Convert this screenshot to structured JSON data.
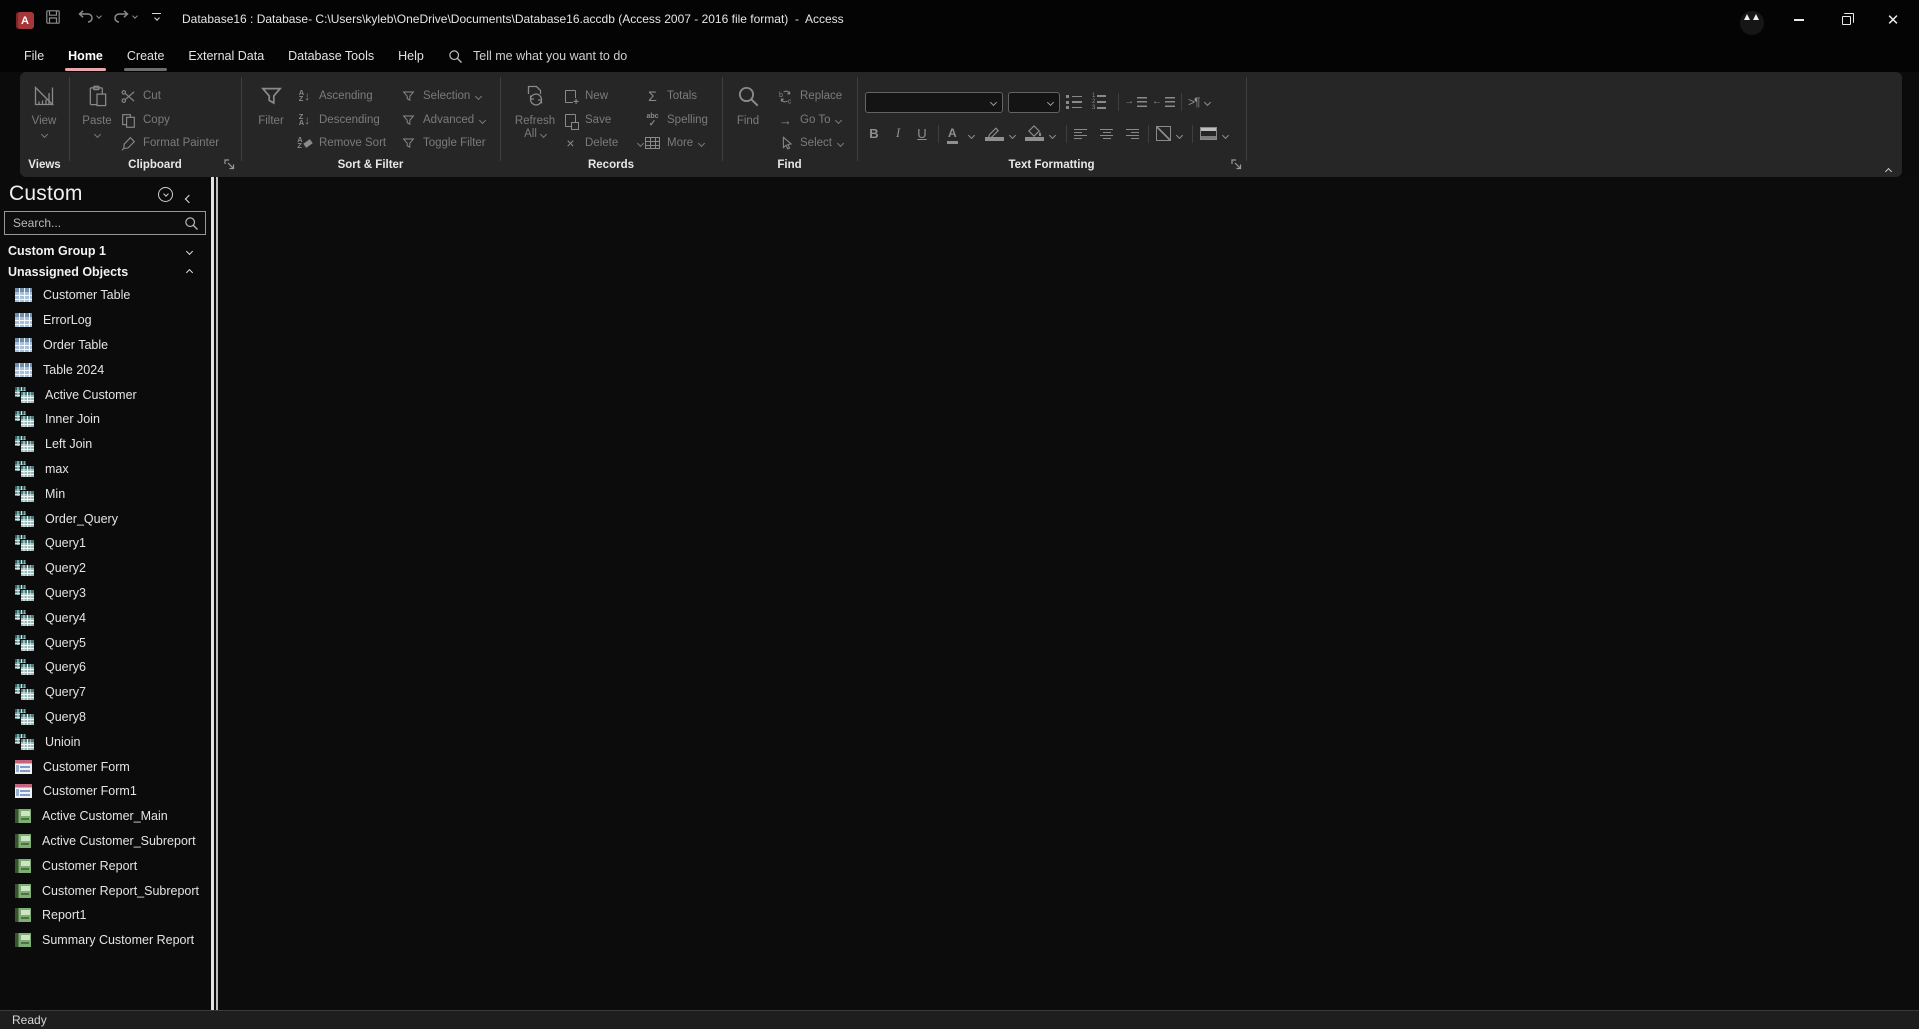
{
  "titlebar": {
    "title": "Database16 : Database- C:\\Users\\kyleb\\OneDrive\\Documents\\Database16.accdb (Access 2007 - 2016 file format)  -  Access",
    "app_letter": "A"
  },
  "tabs": {
    "file": "File",
    "home": "Home",
    "create": "Create",
    "external_data": "External Data",
    "database_tools": "Database Tools",
    "help": "Help"
  },
  "tellme": {
    "placeholder": "Tell me what you want to do"
  },
  "ribbon": {
    "views": {
      "label": "Views",
      "view": "View"
    },
    "clipboard": {
      "label": "Clipboard",
      "paste": "Paste",
      "cut": "Cut",
      "copy": "Copy",
      "format_painter": "Format Painter"
    },
    "sort_filter": {
      "label": "Sort & Filter",
      "filter": "Filter",
      "ascending": "Ascending",
      "descending": "Descending",
      "remove_sort": "Remove Sort",
      "selection": "Selection",
      "advanced": "Advanced",
      "toggle_filter": "Toggle Filter"
    },
    "records": {
      "label": "Records",
      "refresh1": "Refresh",
      "refresh2": "All",
      "new": "New",
      "save": "Save",
      "del": "Delete",
      "totals": "Totals",
      "spelling": "Spelling",
      "more": "More"
    },
    "find": {
      "label": "Find",
      "find": "Find",
      "replace": "Replace",
      "goto": "Go To",
      "select": "Select"
    },
    "text_formatting": {
      "label": "Text Formatting",
      "bold": "B",
      "italic": "I",
      "underline": "U",
      "font_color_letter": "A",
      "direction_mark": ">¶"
    }
  },
  "nav": {
    "title": "Custom",
    "search_placeholder": "Search...",
    "groups": [
      {
        "label": "Custom Group 1",
        "expanded": false
      },
      {
        "label": "Unassigned Objects",
        "expanded": true
      }
    ],
    "items": [
      {
        "label": "Customer Table",
        "type": "table"
      },
      {
        "label": "ErrorLog",
        "type": "table"
      },
      {
        "label": "Order Table",
        "type": "table"
      },
      {
        "label": "Table 2024",
        "type": "table"
      },
      {
        "label": "Active Customer",
        "type": "query"
      },
      {
        "label": "Inner Join",
        "type": "query"
      },
      {
        "label": "Left Join",
        "type": "query"
      },
      {
        "label": "max",
        "type": "query"
      },
      {
        "label": "Min",
        "type": "query"
      },
      {
        "label": "Order_Query",
        "type": "query"
      },
      {
        "label": "Query1",
        "type": "query"
      },
      {
        "label": "Query2",
        "type": "query"
      },
      {
        "label": "Query3",
        "type": "query"
      },
      {
        "label": "Query4",
        "type": "query"
      },
      {
        "label": "Query5",
        "type": "query"
      },
      {
        "label": "Query6",
        "type": "query"
      },
      {
        "label": "Query7",
        "type": "query"
      },
      {
        "label": "Query8",
        "type": "query"
      },
      {
        "label": "Unioin",
        "type": "query"
      },
      {
        "label": "Customer Form",
        "type": "form"
      },
      {
        "label": "Customer Form1",
        "type": "form"
      },
      {
        "label": "Active Customer_Main",
        "type": "report"
      },
      {
        "label": "Active Customer_Subreport",
        "type": "report"
      },
      {
        "label": "Customer Report",
        "type": "report"
      },
      {
        "label": "Customer Report_Subreport",
        "type": "report"
      },
      {
        "label": "Report1",
        "type": "report"
      },
      {
        "label": "Summary Customer Report",
        "type": "report"
      }
    ]
  },
  "status": {
    "text": "Ready"
  }
}
